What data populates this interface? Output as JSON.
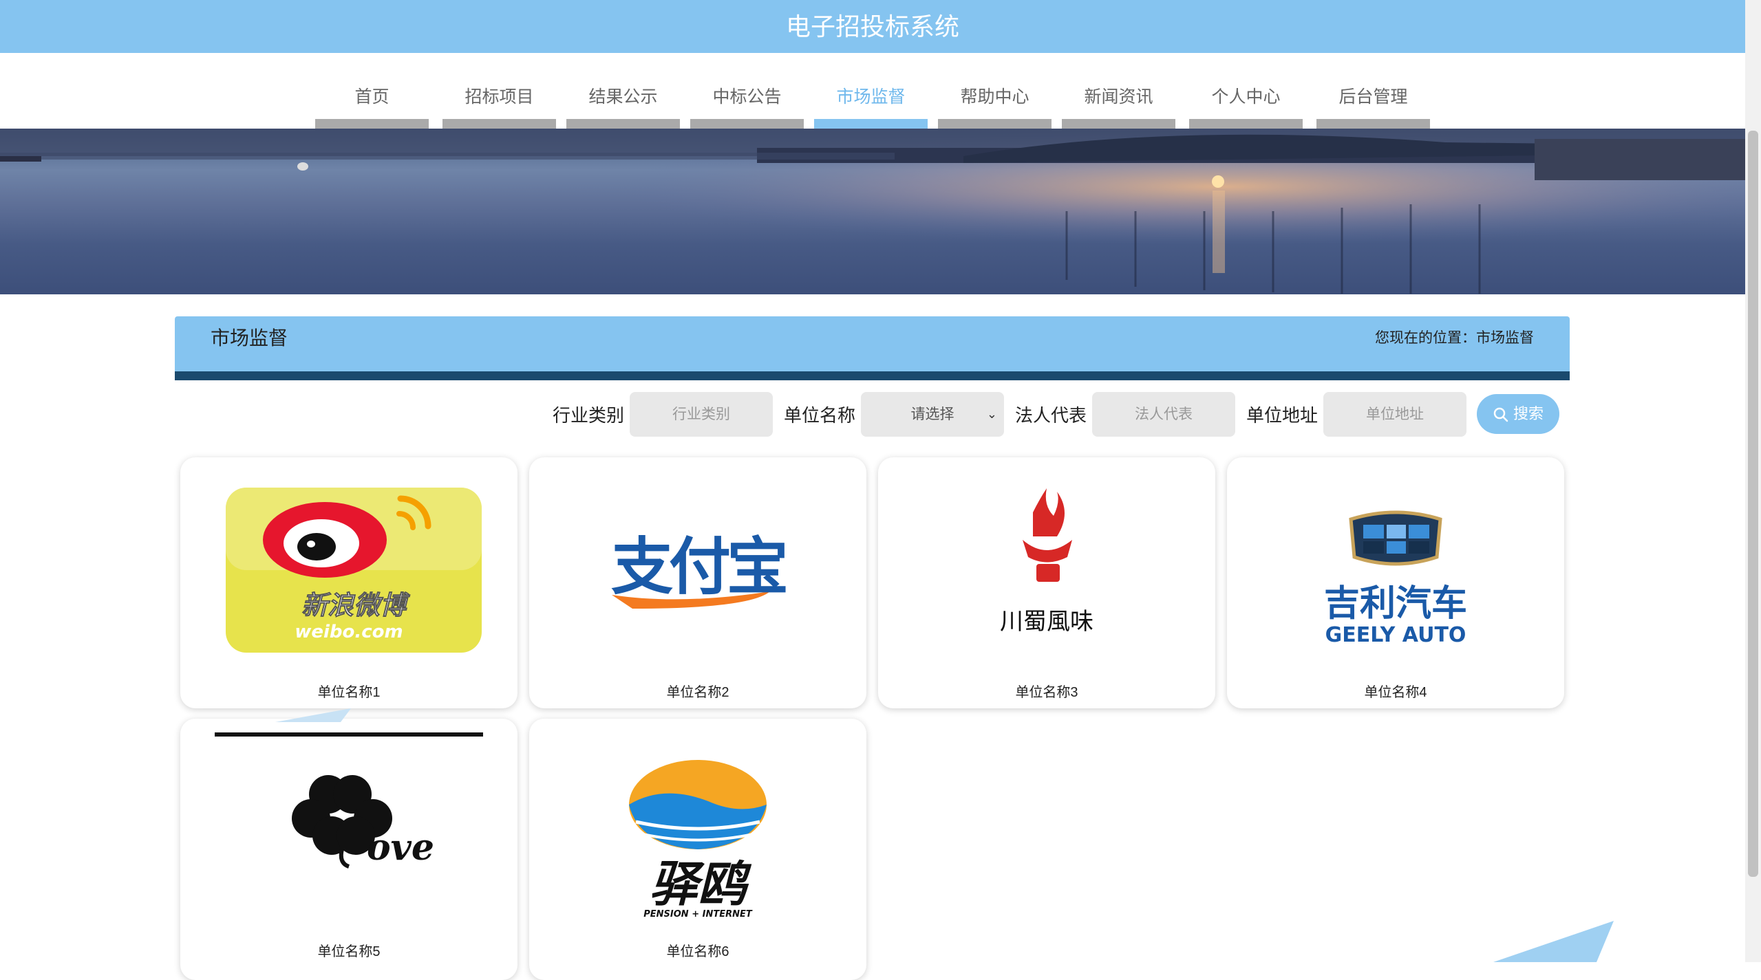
{
  "header": {
    "title": "电子招投标系统"
  },
  "nav": {
    "items": [
      {
        "label": "首页"
      },
      {
        "label": "招标项目"
      },
      {
        "label": "结果公示"
      },
      {
        "label": "中标公告"
      },
      {
        "label": "市场监督"
      },
      {
        "label": "帮助中心"
      },
      {
        "label": "新闻资讯"
      },
      {
        "label": "个人中心"
      },
      {
        "label": "后台管理"
      }
    ],
    "active": "市场监督"
  },
  "section": {
    "title": "市场监督",
    "location_prefix": "您现在的位置：",
    "location": "市场监督"
  },
  "filters": {
    "industry_label": "行业类别",
    "industry_placeholder": "行业类别",
    "company_label": "单位名称",
    "company_select_value": "请选择",
    "legal_label": "法人代表",
    "legal_placeholder": "法人代表",
    "address_label": "单位地址",
    "address_placeholder": "单位地址",
    "search_label": "搜索"
  },
  "cards": [
    {
      "name": "单位名称1",
      "logo_text": "新浪微博",
      "logo_sub": "weibo.com",
      "logo_icon": "weibo-logo"
    },
    {
      "name": "单位名称2",
      "logo_text": "支付宝",
      "logo_icon": "alipay-logo"
    },
    {
      "name": "单位名称3",
      "logo_text": "川蜀風味",
      "logo_icon": "sichuan-flavor-logo"
    },
    {
      "name": "单位名称4",
      "logo_text": "吉利汽车",
      "logo_sub": "GEELY AUTO",
      "logo_icon": "geely-logo"
    },
    {
      "name": "单位名称5",
      "logo_text": "ove",
      "logo_icon": "love-clover-logo"
    },
    {
      "name": "单位名称6",
      "logo_text": "驿鸥",
      "logo_sub": "PENSION + INTERNET",
      "logo_icon": "yiou-logo"
    }
  ],
  "colors": {
    "primary": "#85c4f0",
    "section_border": "#1a4a6e",
    "nav_underline": "#aaaaaa"
  }
}
